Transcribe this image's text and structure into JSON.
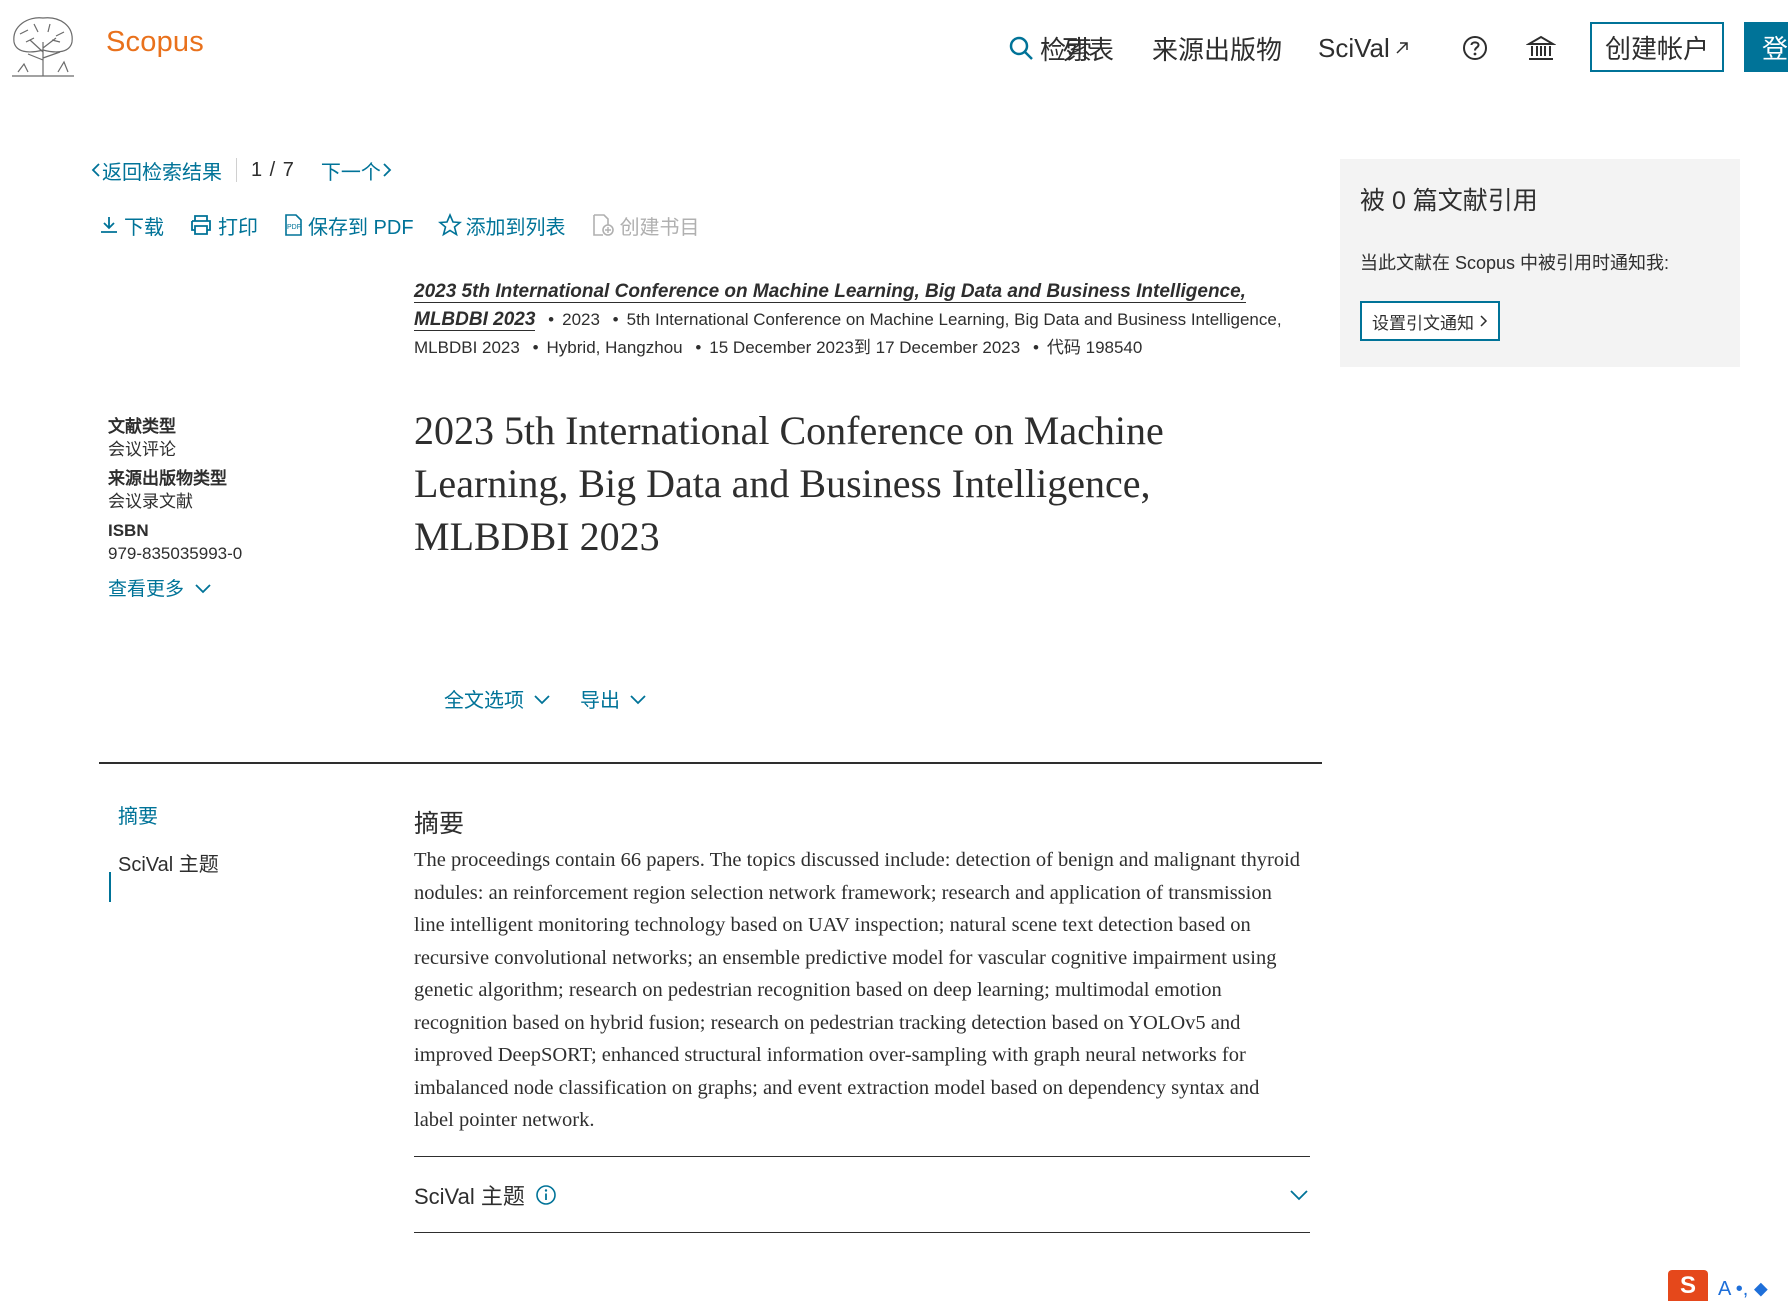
{
  "header": {
    "brand": "Scopus",
    "nav": {
      "search": "检索",
      "lists": "列表",
      "sources": "来源出版物",
      "scival": "SciVal"
    },
    "create_account": "创建帐户",
    "login": "登"
  },
  "breadcrumb": {
    "back": "返回检索结果",
    "pager": "1 / 7",
    "next": "下一个"
  },
  "toolbar": {
    "download": "下载",
    "print": "打印",
    "save_pdf": "保存到 PDF",
    "add_list": "添加到列表",
    "create_bib": "创建书目"
  },
  "source": {
    "title": "2023 5th International Conference on Machine Learning, Big Data and Business Intelligence, MLBDBI 2023",
    "year": "2023",
    "conference": "5th International Conference on Machine Learning, Big Data and Business Intelligence, MLBDBI 2023",
    "location": "Hybrid, Hangzhou",
    "dates": "15 December 2023到 17 December 2023",
    "code": "代码 198540"
  },
  "meta": {
    "doc_type_label": "文献类型",
    "doc_type": "会议评论",
    "source_type_label": "来源出版物类型",
    "source_type": "会议录文献",
    "isbn_label": "ISBN",
    "isbn": "979-835035993-0",
    "show_more": "查看更多"
  },
  "document": {
    "title": "2023 5th International Conference on Machine Learning, Big Data and Business Intelligence, MLBDBI 2023"
  },
  "actions": {
    "fulltext": "全文选项",
    "export": "导出"
  },
  "side_nav": {
    "abstract": "摘要",
    "scival_topics": "SciVal 主题"
  },
  "abstract": {
    "heading": "摘要",
    "text": "The proceedings contain 66 papers. The topics discussed include: detection of benign and malignant thyroid nodules: an reinforcement region selection network framework; research and application of transmission line intelligent monitoring technology based on UAV inspection; natural scene text detection based on recursive convolutional networks; an ensemble predictive model for vascular cognitive impairment using genetic algorithm; research on pedestrian recognition based on deep learning; multimodal emotion recognition based on hybrid fusion; research on pedestrian tracking detection based on YOLOv5 and improved DeepSORT; enhanced structural information over-sampling with graph neural networks for imbalanced node classification on graphs; and event extraction model based on dependency syntax and label pointer network."
  },
  "scival_section": {
    "title": "SciVal 主题"
  },
  "cited_by": {
    "heading": "被 0 篇文献引用",
    "notify_text": "当此文献在 Scopus 中被引用时通知我:",
    "button": "设置引文通知"
  },
  "ime": {
    "text": "A •, ⬥"
  },
  "colors": {
    "accent": "#007398",
    "brand": "#e9711c",
    "text": "#2e2e2e",
    "panel_bg": "#f3f3f3"
  }
}
